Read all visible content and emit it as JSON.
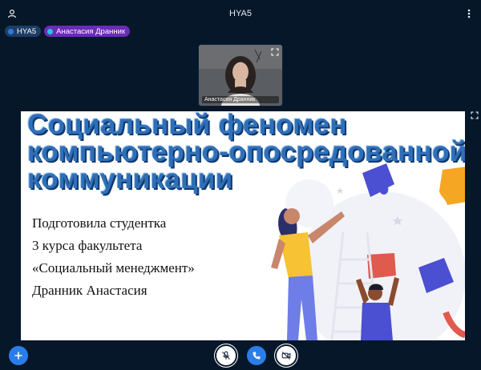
{
  "header": {
    "meeting_title": "HYA5",
    "user_icon": "user-icon",
    "options_icon": "more-vert-icon"
  },
  "participants": [
    {
      "label": "HYA5"
    },
    {
      "label": "Анастасия Дранник"
    }
  ],
  "webcam": {
    "name": "Анастасия Дранник",
    "expand_icon": "fullscreen-icon"
  },
  "presentation": {
    "title_lines": [
      "Социальный  феномен",
      "компьютерно-опосредованной",
      "коммуникации"
    ],
    "body_lines": [
      "Подготовила студентка",
      "3 курса факультета",
      "«Социальный менеджмент»",
      "Дранник Анастасия"
    ],
    "expand_icon": "fullscreen-icon",
    "colors": {
      "title": "#2f6fb8",
      "puzzle_blue": "#4b4fd1",
      "puzzle_orange": "#f5a623",
      "puzzle_red": "#e05a4d",
      "shirt_yellow": "#f7c234"
    }
  },
  "controls": {
    "actions_icon": "plus-icon",
    "mic_icon": "mic-off-icon",
    "audio_icon": "phone-icon",
    "camera_icon": "video-off-icon"
  },
  "theme": {
    "background": "#06172a",
    "accent": "#2b7de9",
    "speaker_chip": "#6c2bb6"
  }
}
